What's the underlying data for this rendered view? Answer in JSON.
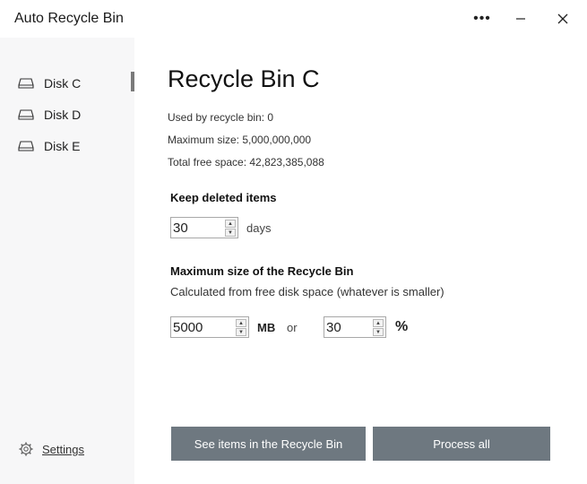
{
  "window": {
    "title": "Auto Recycle Bin",
    "more_label": "•••"
  },
  "sidebar": {
    "items": [
      {
        "label": "Disk C",
        "icon": "drive-icon",
        "selected": true
      },
      {
        "label": "Disk D",
        "icon": "drive-icon",
        "selected": false
      },
      {
        "label": "Disk E",
        "icon": "drive-icon",
        "selected": false
      }
    ],
    "settings_label": "Settings"
  },
  "main": {
    "title": "Recycle Bin C",
    "used_text": "Used by recycle bin: 0",
    "max_text": "Maximum size: 5,000,000,000",
    "free_text": "Total free space: 42,823,385,088",
    "keep": {
      "title": "Keep deleted items",
      "value": "30",
      "unit": "days"
    },
    "max_size": {
      "title": "Maximum size of the Recycle Bin",
      "subtitle": "Calculated from free disk space (whatever is smaller)",
      "mb_value": "5000",
      "mb_unit": "MB",
      "or_label": "or",
      "pct_value": "30",
      "pct_unit": "%"
    }
  },
  "actions": {
    "see_items_label": "See items in the Recycle Bin",
    "process_all_label": "Process all"
  },
  "colors": {
    "button_bg": "#6e7880",
    "sidebar_bg": "#f7f7f8",
    "selection_indicator": "#7a7a7a"
  }
}
